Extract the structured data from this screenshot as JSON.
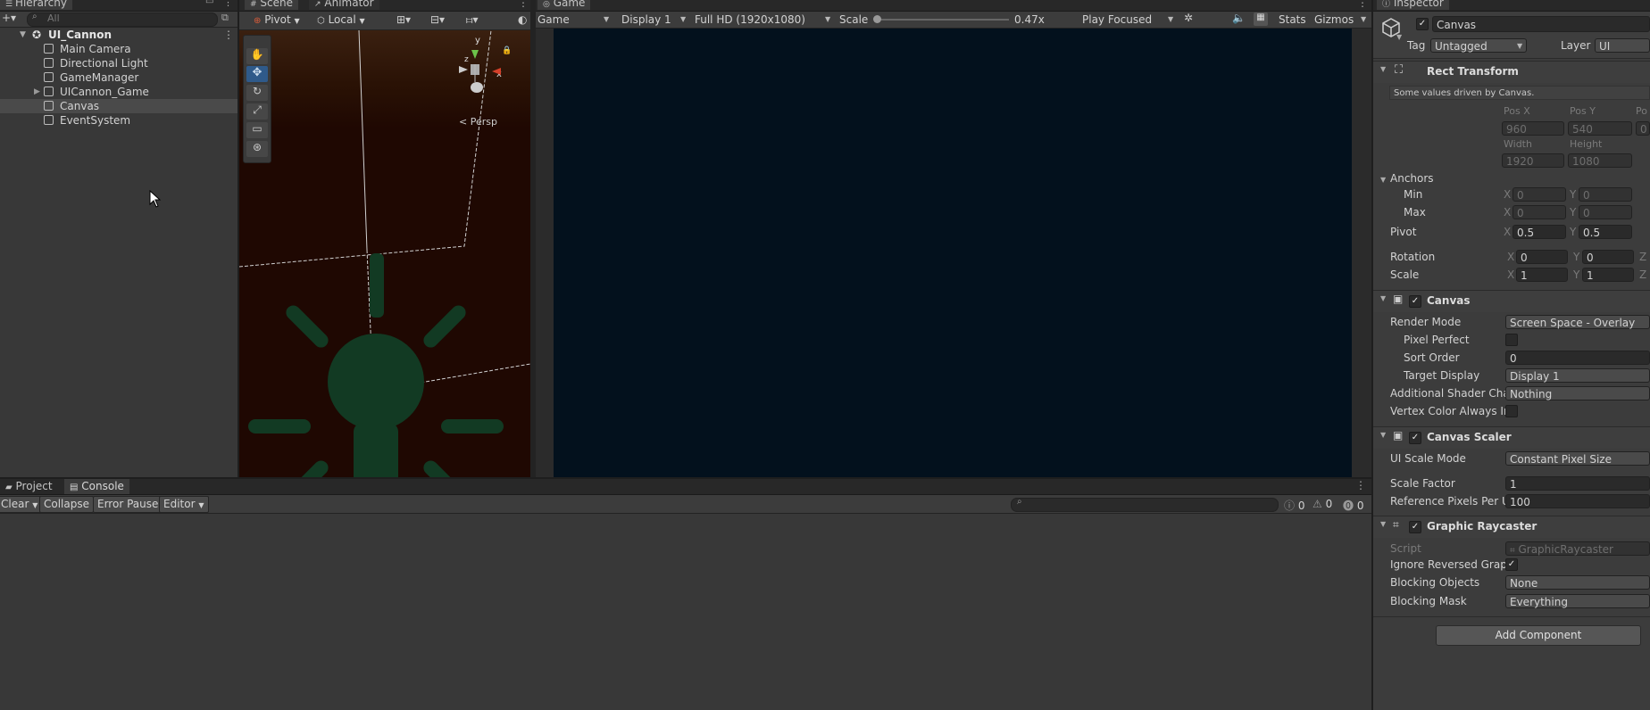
{
  "hierarchy": {
    "tab": "Hierarchy",
    "search_placeholder": "All",
    "root": "UI_Cannon",
    "items": [
      "Main Camera",
      "Directional Light",
      "GameManager",
      "UICannon_Game",
      "Canvas",
      "EventSystem"
    ]
  },
  "scene": {
    "tab_scene": "Scene",
    "tab_animator": "Animator",
    "pivot": "Pivot",
    "local": "Local",
    "persp": "Persp",
    "gizmo_y": "y",
    "gizmo_x": "x",
    "gizmo_z": "z"
  },
  "game": {
    "tab": "Game",
    "view": "Game",
    "display": "Display 1",
    "resolution": "Full HD (1920x1080)",
    "scale_label": "Scale",
    "scale_value": "0.47x",
    "play_mode": "Play Focused",
    "stats": "Stats",
    "gizmos": "Gizmos"
  },
  "console": {
    "tab_project": "Project",
    "tab_console": "Console",
    "clear": "Clear",
    "collapse": "Collapse",
    "error_pause": "Error Pause",
    "editor": "Editor",
    "count_info": "0",
    "count_warn": "0",
    "count_err": "0"
  },
  "inspector": {
    "tab": "Inspector",
    "object_name": "Canvas",
    "tag_label": "Tag",
    "tag_value": "Untagged",
    "layer_label": "Layer",
    "layer_value": "UI",
    "rect_transform": {
      "title": "Rect Transform",
      "note": "Some values driven by Canvas.",
      "pos_x_label": "Pos X",
      "pos_y_label": "Pos Y",
      "pos_z_label": "Po",
      "pos_x": "960",
      "pos_y": "540",
      "pos_z": "0",
      "width_label": "Width",
      "height_label": "Height",
      "width": "1920",
      "height": "1080",
      "anchors": "Anchors",
      "min": "Min",
      "max": "Max",
      "min_x": "0",
      "min_y": "0",
      "max_x": "0",
      "max_y": "0",
      "pivot": "Pivot",
      "pivot_x": "0.5",
      "pivot_y": "0.5",
      "rotation": "Rotation",
      "rot_x": "0",
      "rot_y": "0",
      "scale": "Scale",
      "scale_x": "1",
      "scale_y": "1",
      "x": "X",
      "y": "Y",
      "z": "Z"
    },
    "canvas": {
      "title": "Canvas",
      "render_mode_label": "Render Mode",
      "render_mode": "Screen Space - Overlay",
      "pixel_perfect_label": "Pixel Perfect",
      "sort_order_label": "Sort Order",
      "sort_order": "0",
      "target_display_label": "Target Display",
      "target_display": "Display 1",
      "shader_label": "Additional Shader Cha",
      "shader_value": "Nothing",
      "vertex_label": "Vertex Color Always In"
    },
    "canvas_scaler": {
      "title": "Canvas Scaler",
      "mode_label": "UI Scale Mode",
      "mode": "Constant Pixel Size",
      "scale_factor_label": "Scale Factor",
      "scale_factor": "1",
      "ref_label": "Reference Pixels Per U",
      "ref_value": "100"
    },
    "raycaster": {
      "title": "Graphic Raycaster",
      "script_label": "Script",
      "script": "GraphicRaycaster",
      "ignore_label": "Ignore Reversed Graph",
      "blocking_objects_label": "Blocking Objects",
      "blocking_objects": "None",
      "blocking_mask_label": "Blocking Mask",
      "blocking_mask": "Everything"
    },
    "add_component": "Add Component"
  },
  "colors": {
    "game_view": "#03111d",
    "scene_bg": "#1f0802",
    "panel": "#383838",
    "selected_row": "#4a4a4a"
  }
}
